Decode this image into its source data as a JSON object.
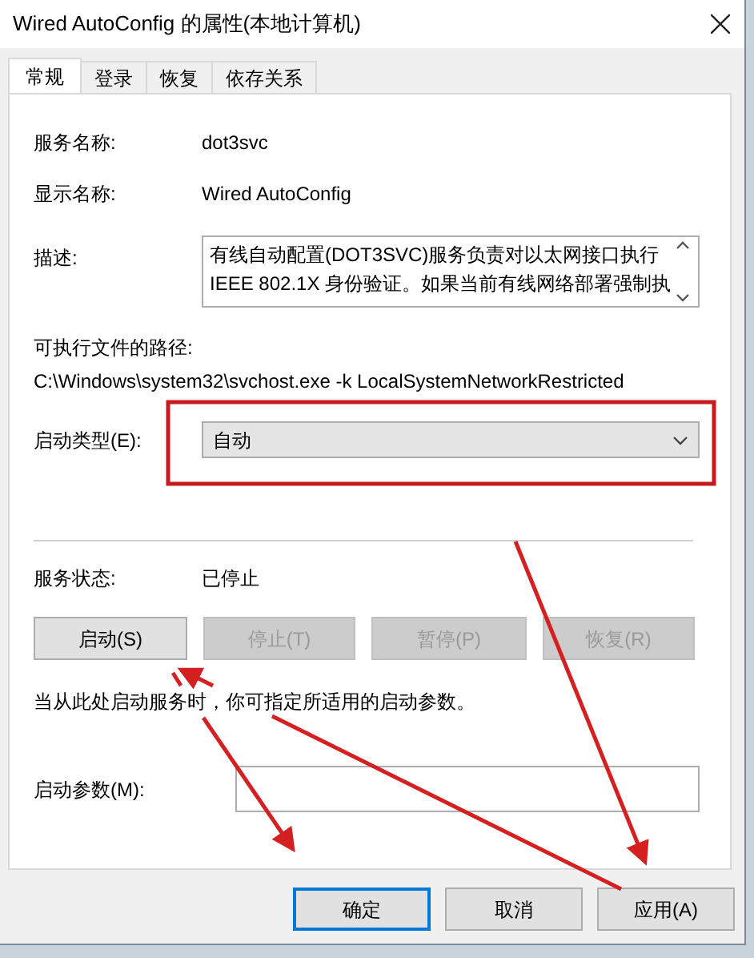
{
  "window": {
    "title": "Wired AutoConfig 的属性(本地计算机)"
  },
  "tabs": [
    {
      "label": "常规",
      "selected": true
    },
    {
      "label": "登录",
      "selected": false
    },
    {
      "label": "恢复",
      "selected": false
    },
    {
      "label": "依存关系",
      "selected": false
    }
  ],
  "service_name": {
    "label": "服务名称:",
    "value": "dot3svc"
  },
  "display_name": {
    "label": "显示名称:",
    "value": "Wired AutoConfig"
  },
  "description": {
    "label": "描述:",
    "lines": [
      "有线自动配置(DOT3SVC)服务负责对以太网接口执行",
      "IEEE 802.1X 身份验证。如果当前有线网络部署强制执"
    ]
  },
  "executable_path": {
    "label": "可执行文件的路径:",
    "value": "C:\\Windows\\system32\\svchost.exe -k LocalSystemNetworkRestricted"
  },
  "startup_type": {
    "label": "启动类型(E):",
    "value": "自动"
  },
  "service_status": {
    "label": "服务状态:",
    "value": "已停止"
  },
  "service_buttons": [
    {
      "label": "启动(S)",
      "disabled": false
    },
    {
      "label": "停止(T)",
      "disabled": true
    },
    {
      "label": "暂停(P)",
      "disabled": true
    },
    {
      "label": "恢复(R)",
      "disabled": true
    }
  ],
  "hint": "当从此处启动服务时，你可指定所适用的启动参数。",
  "start_parameters": {
    "label": "启动参数(M):"
  },
  "dialog_buttons": [
    {
      "label": "确定",
      "default": true
    },
    {
      "label": "取消",
      "default": false
    },
    {
      "label": "应用(A)",
      "default": false
    }
  ]
}
